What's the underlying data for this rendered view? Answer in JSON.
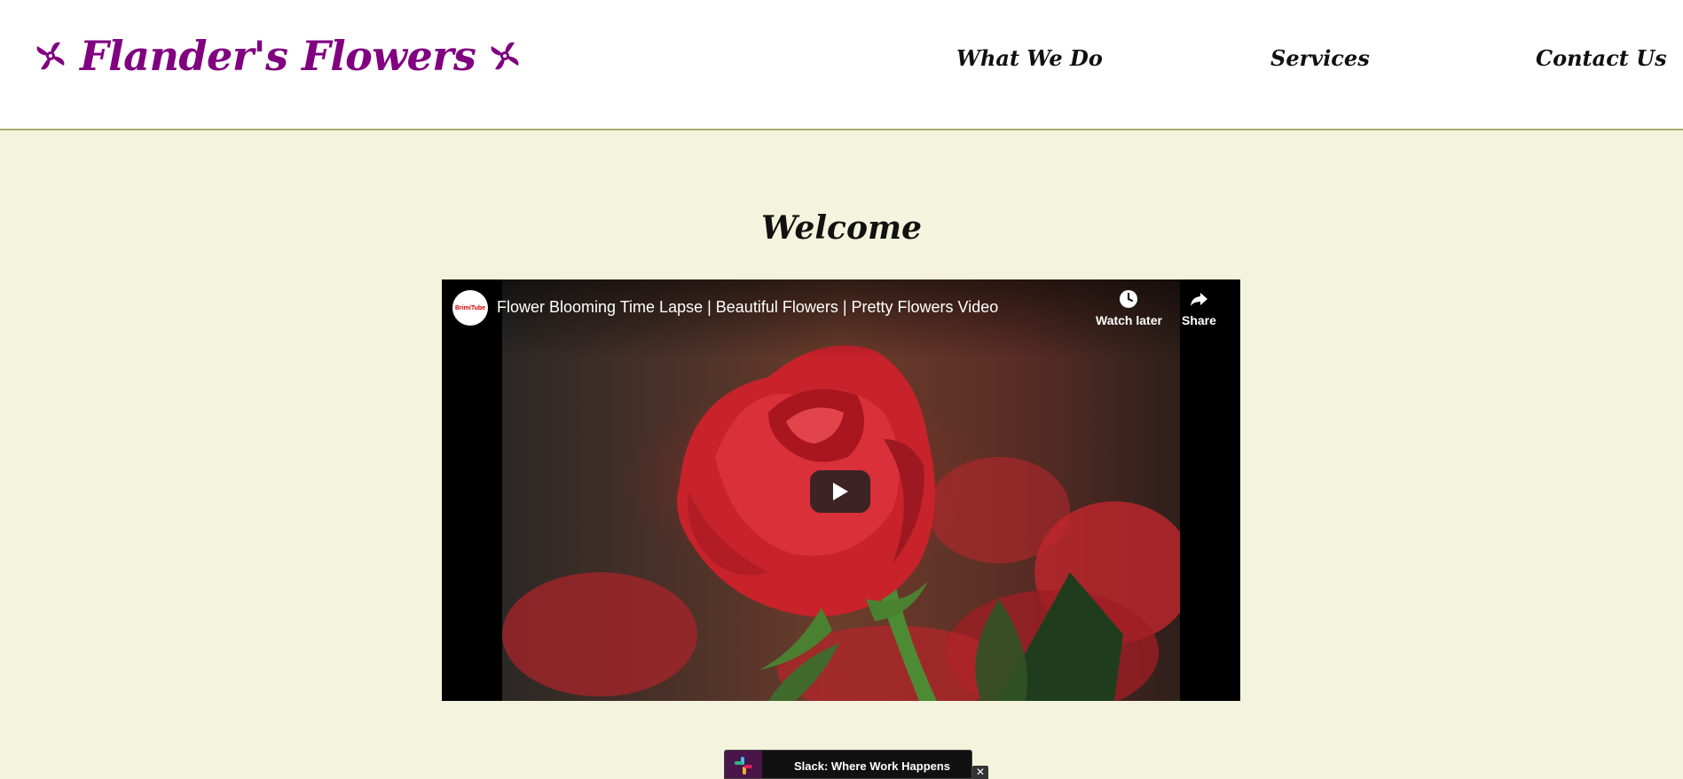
{
  "header": {
    "brand": "Flander's Flowers",
    "brand_icon": "pinwheel-flower-icon",
    "brand_color": "#800080",
    "nav": [
      {
        "label": "What We Do"
      },
      {
        "label": "Services"
      },
      {
        "label": "Contact Us"
      }
    ]
  },
  "main": {
    "heading": "Welcome",
    "background_color": "#f4f4de"
  },
  "video": {
    "channel_logo": "BrimiTube",
    "title": "Flower Blooming Time Lapse | Beautiful Flowers | Pretty Flowers Video",
    "watch_later_label": "Watch later",
    "share_label": "Share",
    "watch_later_icon": "clock-icon",
    "share_icon": "share-arrow-icon",
    "play_icon": "play-icon"
  },
  "ad": {
    "text": "Slack: Where Work Happens",
    "logo_icon": "slack-logo-icon",
    "close_label": "✕"
  }
}
